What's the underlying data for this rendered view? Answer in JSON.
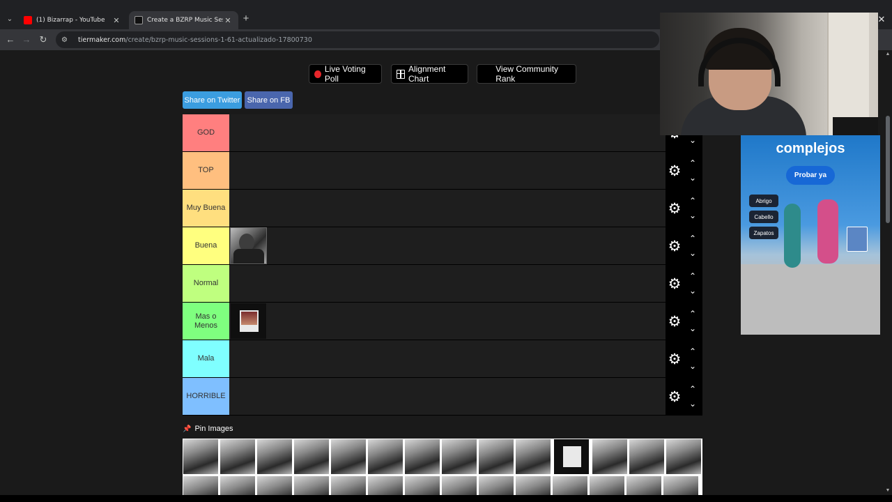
{
  "browser": {
    "tabs": [
      {
        "title": "(1) Bizarrap - YouTube",
        "favicon_color": "#ff0000",
        "active": false
      },
      {
        "title": "Create a BZRP Music Sessions",
        "favicon_color": "#111111",
        "active": true
      }
    ],
    "url_host": "tiermaker.com",
    "url_path": "/create/bzrp-music-sessions-1-61-actualizado-17800730"
  },
  "top_buttons": {
    "live_voting": "Live Voting Poll",
    "alignment_chart": "Alignment Chart",
    "community_rank": "View Community Rank"
  },
  "share": {
    "twitter": "Share on Twitter",
    "facebook": "Share on FB"
  },
  "tiers": [
    {
      "label": "GOD",
      "color": "#ff7f7f",
      "items": 0
    },
    {
      "label": "TOP",
      "color": "#ffbf7f",
      "items": 0
    },
    {
      "label": "Muy Buena",
      "color": "#ffdf7f",
      "items": 0
    },
    {
      "label": "Buena",
      "color": "#ffff7f",
      "items": 1
    },
    {
      "label": "Normal",
      "color": "#bfff7f",
      "items": 0
    },
    {
      "label": "Mas o Menos",
      "color": "#7fff7f",
      "items": 1
    },
    {
      "label": "Mala",
      "color": "#7fffff",
      "items": 0
    },
    {
      "label": "HORRIBLE",
      "color": "#7fbfff",
      "items": 0
    }
  ],
  "pin_images": "Pin Images",
  "ad": {
    "headline": "complejos",
    "cta": "Probar ya",
    "chips": [
      "Abrigo",
      "Cabello",
      "Zapatos"
    ]
  }
}
